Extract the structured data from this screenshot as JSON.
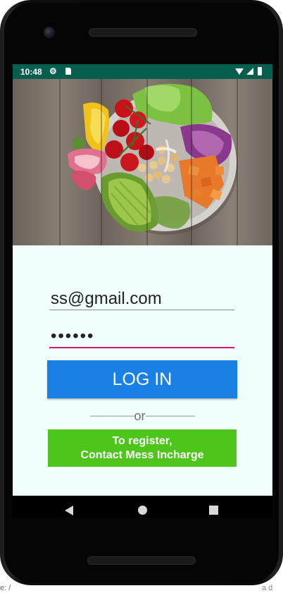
{
  "status_bar": {
    "time": "10:48",
    "icons": [
      "gear-icon",
      "sd-card-icon",
      "wifi-icon",
      "signal-icon",
      "battery-icon"
    ],
    "background": "#075e4e"
  },
  "hero_image": {
    "description_icon": "salad-bowl-photo"
  },
  "login_form": {
    "email_value": "ss@gmail.com",
    "password_value": "••••••",
    "login_label": "LOG IN",
    "divider_left": "---------------------------",
    "divider_text": "or",
    "divider_right": "------------------------------",
    "register_line1": "To register,",
    "register_line2": "Contact Mess Incharge"
  },
  "colors": {
    "form_background": "#f0fefe",
    "login_button": "#1a80e6",
    "register_button": "#4dc51a",
    "password_underline": "#d81b60"
  },
  "nav_bar": {
    "icons": [
      "back-icon",
      "home-icon",
      "recents-icon"
    ]
  },
  "page_fragments": {
    "left": "e: /",
    "right": "a d"
  }
}
